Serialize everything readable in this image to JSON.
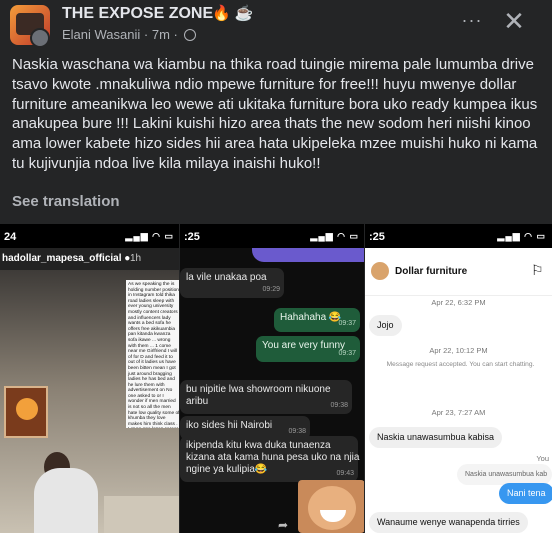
{
  "header": {
    "group_name": "THE EXPOSE ZONE",
    "group_emojis": "🔥 ☕",
    "author": "Elani Wasanii",
    "time": "7m",
    "more_icon": "ellipsis-icon",
    "close_icon": "close-icon"
  },
  "post": {
    "text": "Naskia waschana wa kiambu na thika road tuingie mirema pale lumumba drive tsavo  kwote .mnakuliwa ndio mpewe furniture for free!!! huyu mwenye dollar furniture ameanikwa leo wewe ati ukitaka furniture bora uko ready kumpea ikus anakupea bure !!! Lakini kuishi hizo area thats the new sodom heri niishi kinoo ama lower kabete hizo sides hii area hata ukipeleka mzee muishi huko ni kama tu kujivunjia ndoa live kila milaya inaishi huko!!",
    "see_translation": "See translation"
  },
  "panels": {
    "p1": {
      "status_time": "24",
      "username": "hadollar_mapesa_official",
      "verified": "●",
      "ago": "1h",
      "overlay_text": "As we speaking the is holding number position in Instagram told thika road ladies sleep with ever young university mostly content creators and influencers lady wants a bed sofa he offers free akikuambia pan kitanda kwanza sofa ikawe ... wrong with them ... 1 come near me Girlfriend I will of for D and feed it to out of it ladies us have been bitten mean I got just around bragging ladies he has bed and he lure them with advertisement on No one asked to or I wonder if men married is not so all the men hate low quality some of khumba they love makes him think class . Let no one loses career ... hakuwa maisha"
    },
    "p2": {
      "status_time": ":25",
      "messages": [
        {
          "text": "la vile unakaa poa",
          "time": "09:29",
          "dir": "in"
        },
        {
          "text": "Hahahaha 😂",
          "time": "09:37",
          "dir": "out"
        },
        {
          "text": "You are very funny",
          "time": "09:37",
          "dir": "out"
        },
        {
          "text": "bu nipitie lwa showroom nikuone",
          "time": "",
          "dir": "in"
        },
        {
          "text": "aribu",
          "time": "09:38",
          "dir": "in"
        },
        {
          "text": "iko sides hii Nairobi",
          "time": "09:38",
          "dir": "in"
        },
        {
          "text": "ikipenda kitu kwa duka tunaenza",
          "time": "",
          "dir": "in"
        },
        {
          "text": "kizana ata kama huna pesa uko na njia",
          "time": "",
          "dir": "in"
        },
        {
          "text": "ngine ya kulipia😂",
          "time": "09:43",
          "dir": "in"
        }
      ],
      "forward_icon": "forward-arrow-icon"
    },
    "p3": {
      "status_time": ":25",
      "contact": "Dollar furniture",
      "flag_icon": "flag-icon",
      "ts1": "Apr 22, 6:32 PM",
      "msg1": "Jojo",
      "ts2": "Apr 22, 10:12 PM",
      "note": "Message request accepted. You can start chatting.",
      "ts3": "Apr 23, 7:27 AM",
      "msg2": "Naskia unawasumbua kabisa",
      "reply_label": "You",
      "reply": "Naskia unawasumbua kab",
      "msg3": "Nani tena",
      "msg4": "Wanaume wenye wanapenda tirries"
    }
  }
}
